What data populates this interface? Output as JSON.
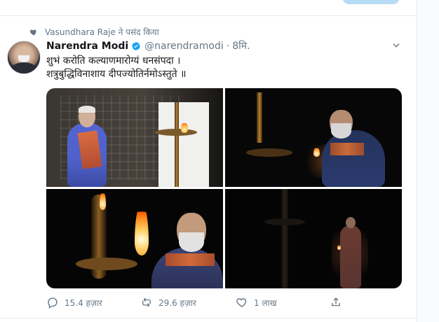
{
  "social_context": {
    "label": "Vasundhara Raje ने पसंद किया"
  },
  "tweet": {
    "author_name": "Narendra Modi",
    "handle": "@narendramodi",
    "separator": "·",
    "time": "8मि.",
    "text_lines": [
      "शुभं करोति कल्याणमारोग्यं धनसंपदा ।",
      "शत्रुबुद्धिविनाशाय दीपज्योतिर्नमोऽस्तुते ॥"
    ]
  },
  "actions": {
    "reply_count": "15.4 हज़ार",
    "retweet_count": "29.6 हज़ार",
    "like_count": "1 लाख"
  },
  "colors": {
    "brand_blue": "#1da1f2",
    "meta_gray": "#657786",
    "text_dark": "#14171a",
    "divider": "#e6ecf0"
  },
  "icons": {
    "social_context": "heart-icon",
    "verified": "verified-icon",
    "menu": "chevron-down-icon",
    "reply": "reply-icon",
    "retweet": "retweet-icon",
    "like": "heart-outline-icon",
    "share": "share-icon"
  }
}
